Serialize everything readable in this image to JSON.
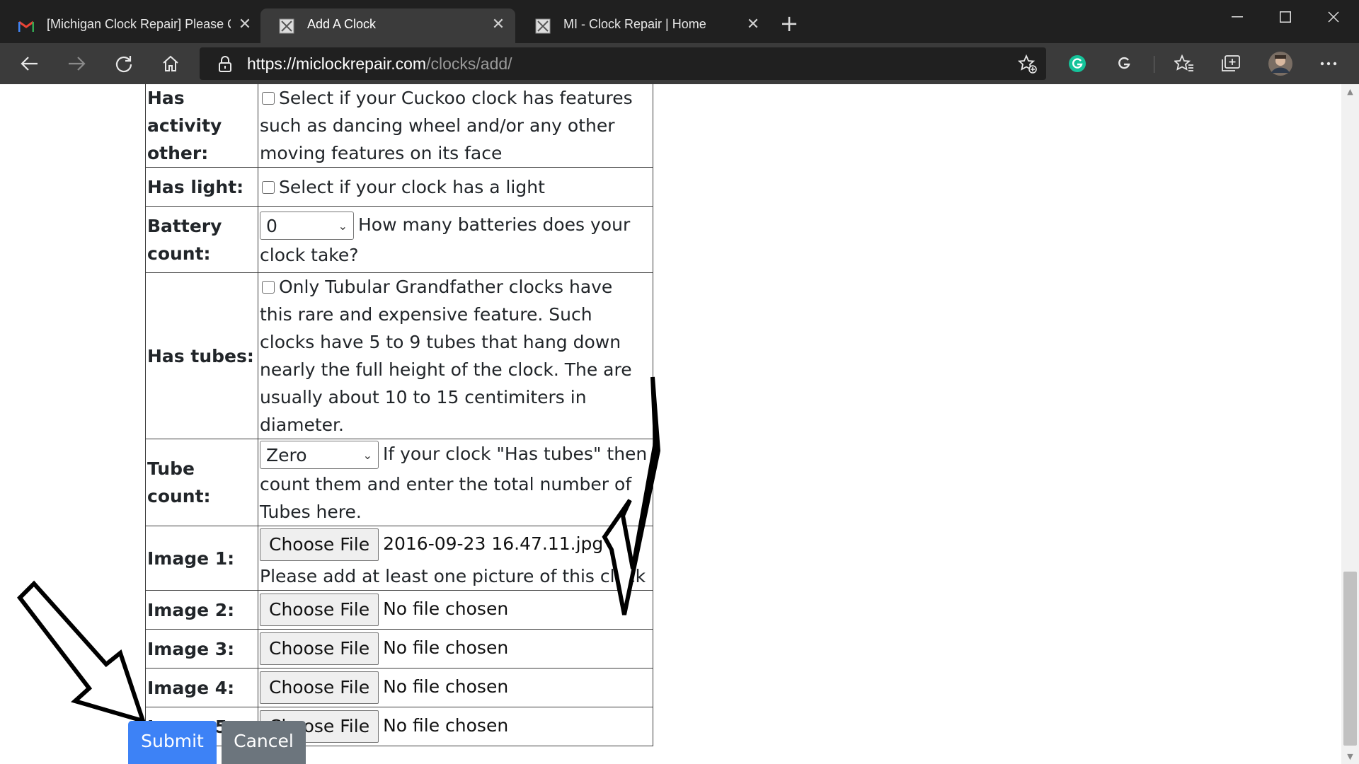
{
  "browser": {
    "tabs": [
      {
        "title": "[Michigan Clock Repair] Please C",
        "icon": "gmail-icon"
      },
      {
        "title": "Add A Clock",
        "icon": "site-favicon-icon"
      },
      {
        "title": "MI - Clock Repair | Home",
        "icon": "site-favicon-icon"
      }
    ],
    "active_tab_index": 1,
    "url_host": "https://miclockrepair.com",
    "url_path": "/clocks/add/"
  },
  "form": {
    "rows": {
      "activity_other": {
        "label": "Has activity other:",
        "help": "Select if your Cuckoo clock has features such as dancing wheel and/or any other moving features on its face",
        "checked": false
      },
      "light": {
        "label": "Has light:",
        "help": "Select if your clock has a light",
        "checked": false
      },
      "battery": {
        "label": "Battery count:",
        "selected": "0",
        "help": "How many batteries does your clock take?"
      },
      "tubes": {
        "label": "Has tubes:",
        "help": "Only Tubular Grandfather clocks have this rare and expensive feature. Such clocks have 5 to 9 tubes that hang down nearly the full height of the clock. The are usually about 10 to 15 centimiters in diameter.",
        "checked": false
      },
      "tube_count": {
        "label": "Tube count:",
        "selected": "Zero",
        "help": "If your clock \"Has tubes\" then count them and enter the total number of Tubes here."
      },
      "image1": {
        "label": "Image 1:",
        "button": "Choose File",
        "file": "2016-09-23 16.47.11.jpg",
        "help": "Please add at least one picture of this clock"
      },
      "image2": {
        "label": "Image 2:",
        "button": "Choose File",
        "file": "No file chosen"
      },
      "image3": {
        "label": "Image 3:",
        "button": "Choose File",
        "file": "No file chosen"
      },
      "image4": {
        "label": "Image 4:",
        "button": "Choose File",
        "file": "No file chosen"
      },
      "image5": {
        "label": "Image 5:",
        "button": "Choose File",
        "file": "No file chosen"
      }
    },
    "submit_label": "Submit",
    "cancel_label": "Cancel"
  },
  "colors": {
    "submit": "#3d82f6",
    "cancel": "#6c757d",
    "chrome_dark": "#202020",
    "chrome_toolbar": "#3b3b3b"
  }
}
